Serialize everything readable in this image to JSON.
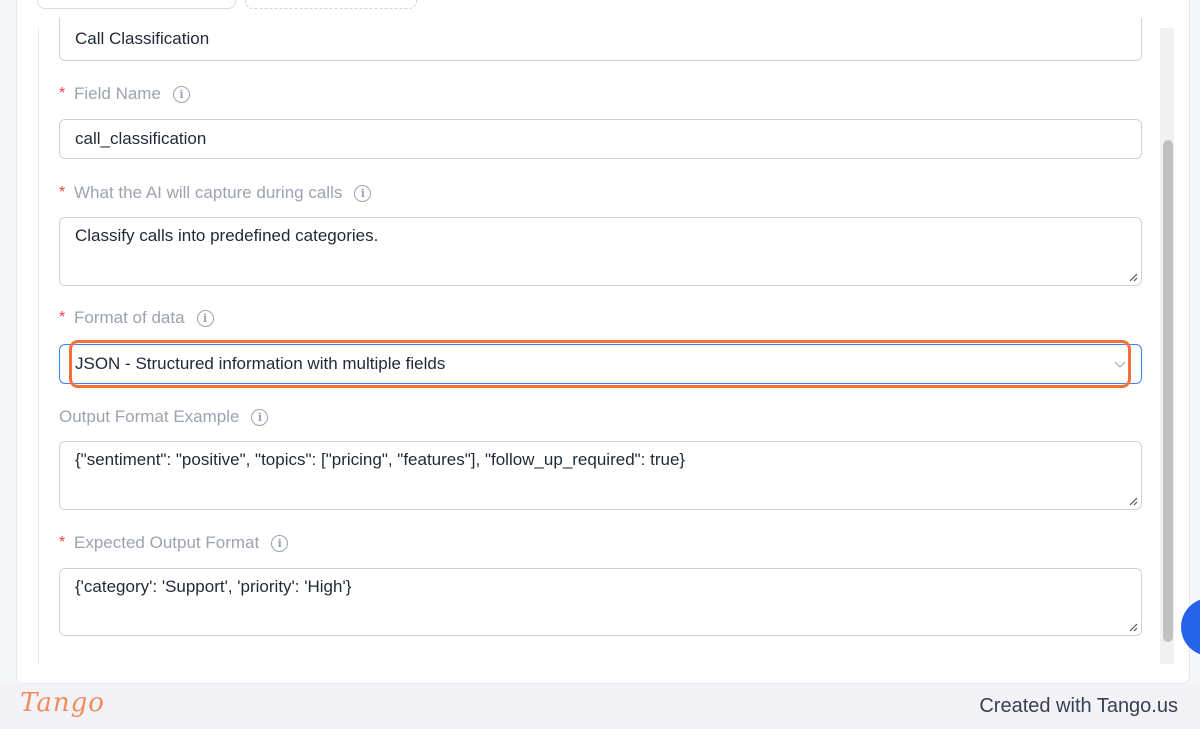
{
  "form": {
    "classification_name_value": "Call Classification",
    "field_name": {
      "required_mark": "*",
      "label": "Field Name",
      "value": "call_classification"
    },
    "capture": {
      "required_mark": "*",
      "label": "What the AI will capture during calls",
      "value": "Classify calls into predefined categories."
    },
    "format": {
      "required_mark": "*",
      "label": "Format of data",
      "selected": "JSON - Structured information with multiple fields"
    },
    "output_example": {
      "label": "Output Format Example",
      "value": "{\"sentiment\": \"positive\", \"topics\": [\"pricing\", \"features\"], \"follow_up_required\": true}"
    },
    "expected_output": {
      "required_mark": "*",
      "label": "Expected Output Format",
      "value": "{'category': 'Support', 'priority': 'High'}"
    },
    "info_glyph": "i"
  },
  "footer": {
    "logo": "Tango",
    "credit": "Created with Tango.us"
  },
  "colors": {
    "highlight": "#f4703b",
    "required": "#ef4444",
    "focus": "#3b82f6",
    "fab": "#2563eb"
  }
}
